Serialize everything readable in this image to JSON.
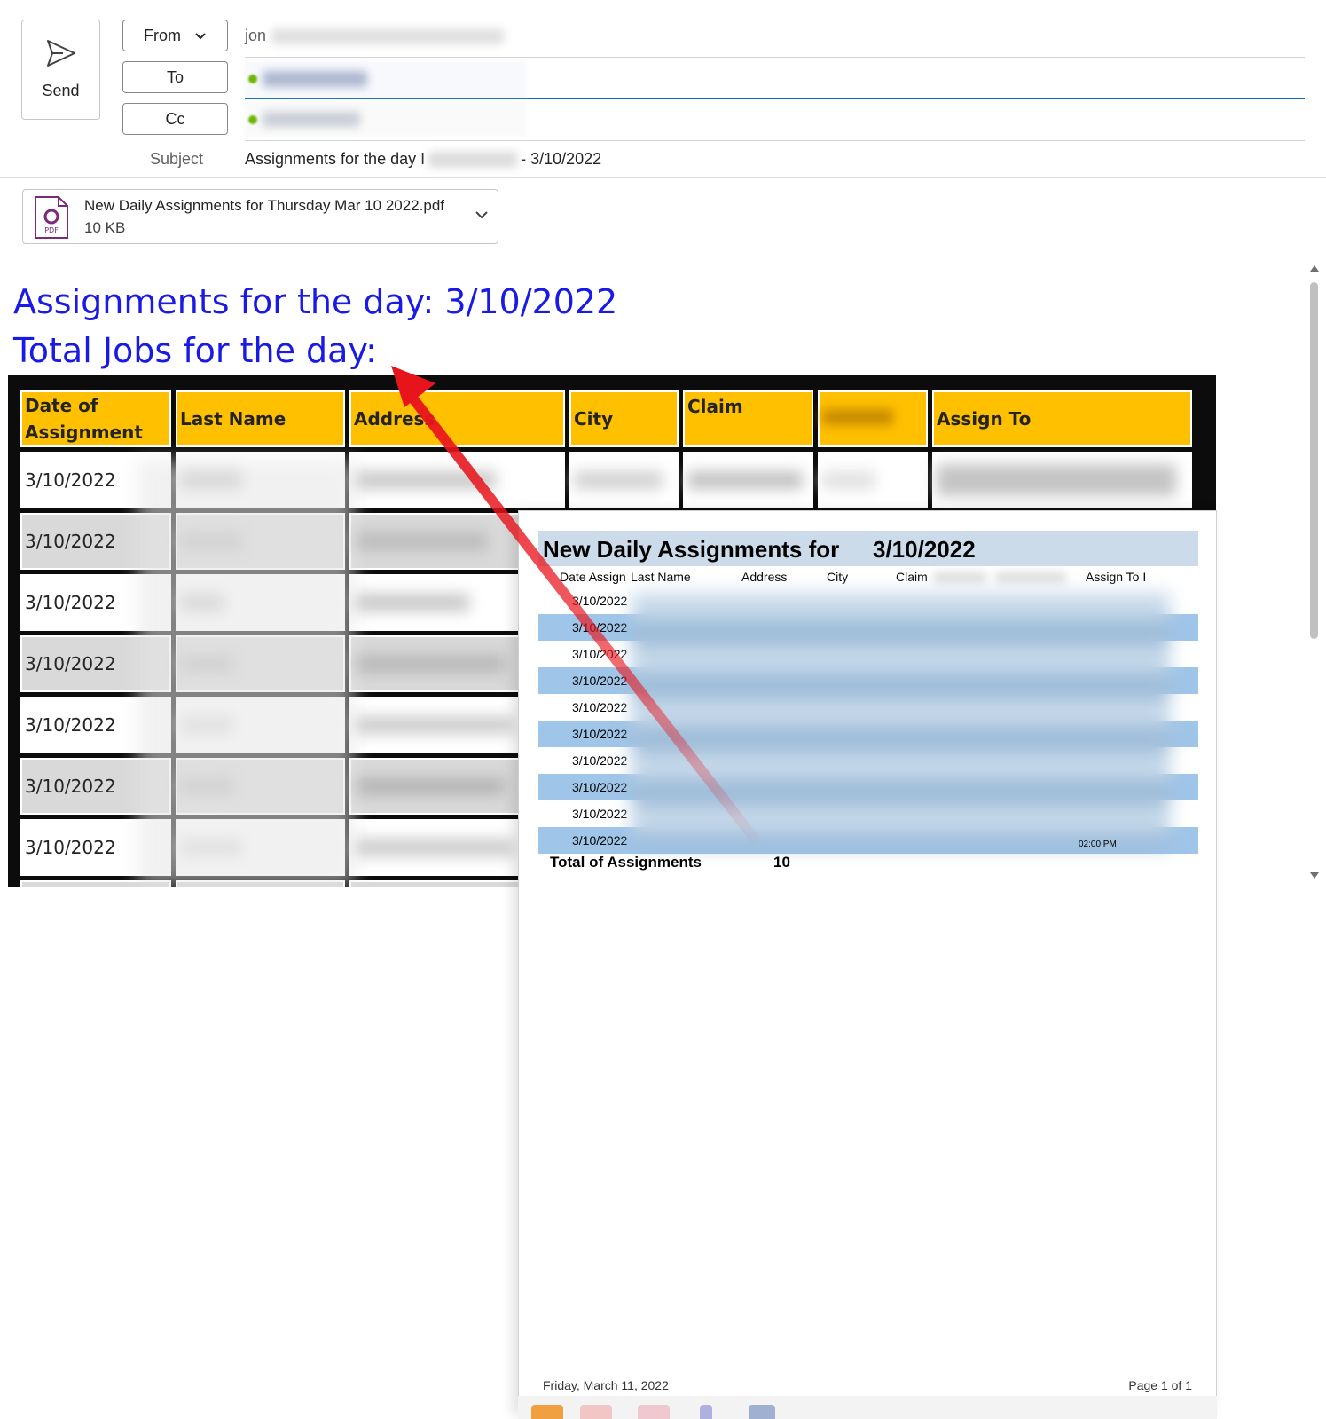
{
  "compose": {
    "send_label": "Send",
    "from_label": "From",
    "to_label": "To",
    "cc_label": "Cc",
    "from_value": "jon",
    "subject_label": "Subject",
    "subject_value_start": "Assignments for the day I",
    "subject_value_end": "- 3/10/2022"
  },
  "attachment": {
    "file_name": "New Daily Assignments for Thursday Mar 10 2022.pdf",
    "file_size": "10 KB",
    "icon_text": "PDF"
  },
  "body": {
    "title_line1": "Assignments for the day: 3/10/2022",
    "title_line2": "Total Jobs for the day:",
    "table": {
      "headers": [
        "Date of Assignment",
        "Last Name",
        "Address",
        "City",
        "Claim",
        "",
        "Assign To"
      ],
      "rows": [
        {
          "date": "3/10/2022"
        },
        {
          "date": "3/10/2022"
        },
        {
          "date": "3/10/2022"
        },
        {
          "date": "3/10/2022"
        },
        {
          "date": "3/10/2022"
        },
        {
          "date": "3/10/2022"
        },
        {
          "date": "3/10/2022"
        }
      ]
    }
  },
  "pdf_preview": {
    "title": "New Daily Assignments for",
    "title_date": "3/10/2022",
    "columns": [
      "Date Assign",
      "Last Name",
      "Address",
      "City",
      "Claim",
      "Assign To I"
    ],
    "rows": [
      "3/10/2022",
      "3/10/2022",
      "3/10/2022",
      "3/10/2022",
      "3/10/2022",
      "3/10/2022",
      "3/10/2022",
      "3/10/2022",
      "3/10/2022",
      "3/10/2022"
    ],
    "time_text": "02:00 PM",
    "total_label": "Total of Assignments",
    "total_value": "10",
    "footer_date": "Friday, March 11, 2022",
    "footer_page": "Page 1 of 1"
  },
  "colors": {
    "title_blue": "#1a1ae6",
    "header_yellow": "#ffc000",
    "row_gray": "#d9d9d9",
    "pdf_row_blue": "#9fc5e8",
    "arrow_red": "#e8141c"
  }
}
